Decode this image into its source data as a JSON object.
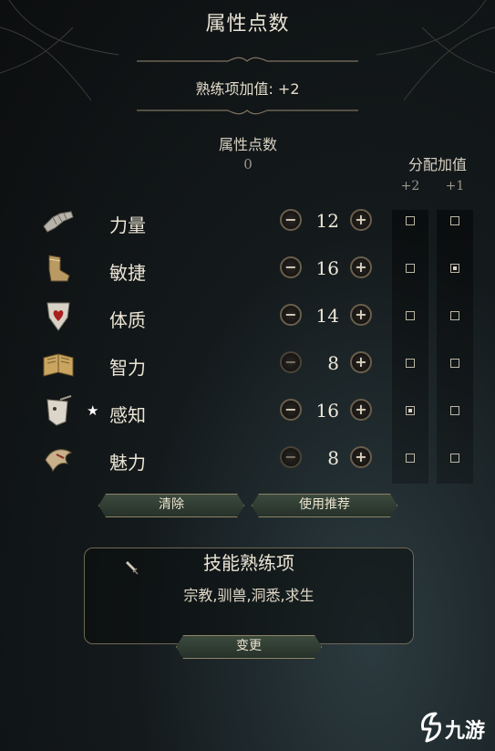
{
  "header": {
    "title": "属性点数"
  },
  "proficiency": {
    "bonus_text": "熟练项加值: +2"
  },
  "ability_points": {
    "label": "属性点数",
    "value": "0"
  },
  "allocation": {
    "label": "分配加值",
    "plus2": "+2",
    "plus1": "+1"
  },
  "abilities": [
    {
      "name": "力量",
      "icon": "gauntlet-icon",
      "score": "12",
      "minus_enabled": true,
      "starred": false,
      "plus2": false,
      "plus1": false
    },
    {
      "name": "敏捷",
      "icon": "boot-icon",
      "score": "16",
      "minus_enabled": true,
      "starred": false,
      "plus2": false,
      "plus1": true
    },
    {
      "name": "体质",
      "icon": "heart-shield-icon",
      "score": "14",
      "minus_enabled": true,
      "starred": false,
      "plus2": false,
      "plus1": false
    },
    {
      "name": "智力",
      "icon": "open-book-icon",
      "score": "8",
      "minus_enabled": false,
      "starred": false,
      "plus2": false,
      "plus1": false
    },
    {
      "name": "感知",
      "icon": "wisdom-mask-icon",
      "score": "16",
      "minus_enabled": true,
      "starred": true,
      "star": "★",
      "plus2": true,
      "plus1": false
    },
    {
      "name": "魅力",
      "icon": "charisma-bird-icon",
      "score": "8",
      "minus_enabled": false,
      "starred": false,
      "plus2": false,
      "plus1": false
    }
  ],
  "buttons": {
    "clear": "清除",
    "recommended": "使用推荐",
    "change": "变更"
  },
  "skills": {
    "title": "技能熟练项",
    "list": "宗教,驯兽,洞悉,求生"
  },
  "watermark": {
    "logo_text": "九游"
  },
  "colors": {
    "accent_gold": "#8d8466",
    "button_green": "#3c4a3d",
    "text": "#e6e0d2"
  }
}
